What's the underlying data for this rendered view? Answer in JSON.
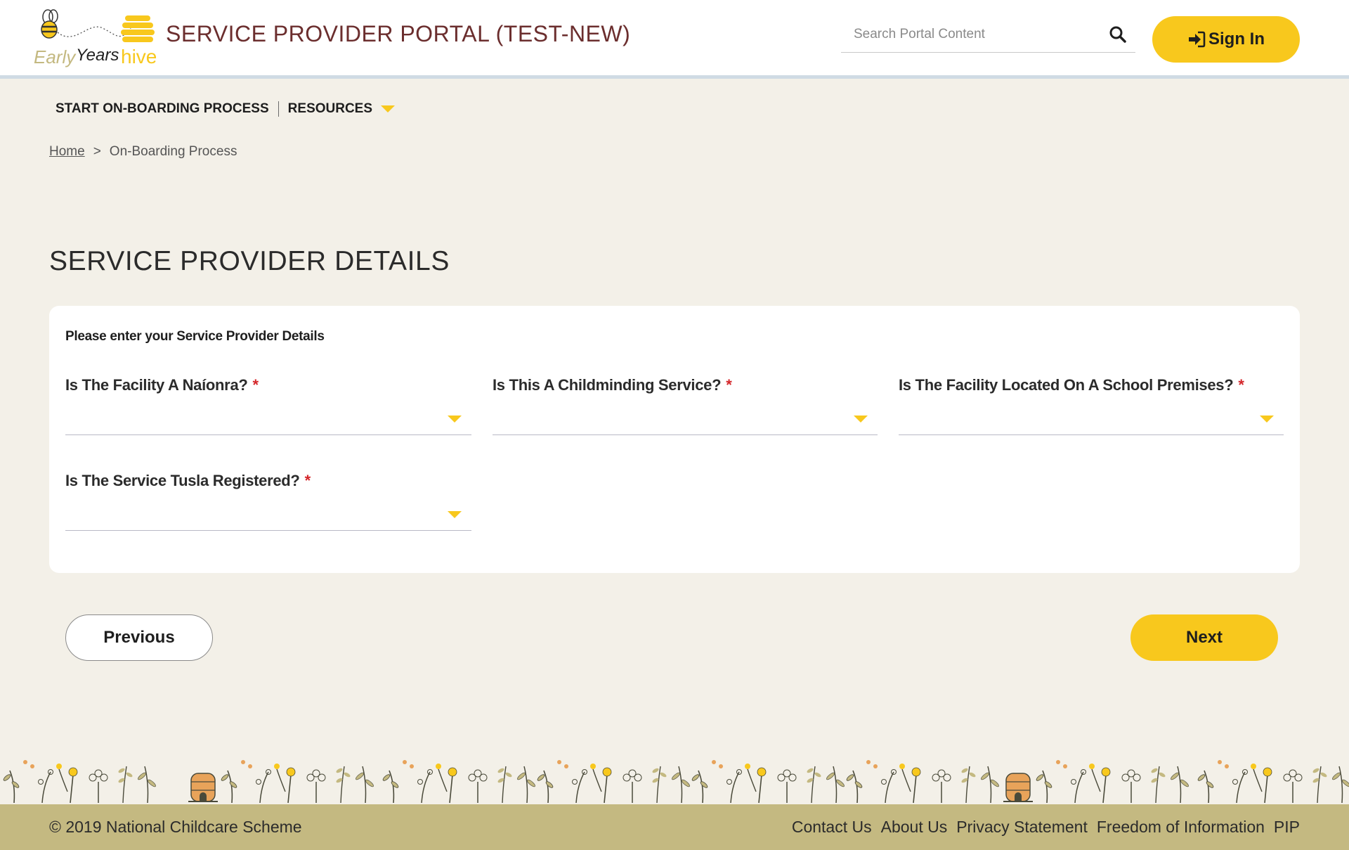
{
  "header": {
    "logo_text": "Early Years hive",
    "portal_title": "SERVICE PROVIDER PORTAL (TEST-NEW)",
    "search_placeholder": "Search Portal Content",
    "sign_in_label": "Sign In"
  },
  "nav": {
    "items": [
      {
        "label": "START ON-BOARDING PROCESS"
      },
      {
        "label": "RESOURCES"
      }
    ]
  },
  "breadcrumb": {
    "home": "Home",
    "separator": ">",
    "current": "On-Boarding Process"
  },
  "page": {
    "title": "SERVICE PROVIDER DETAILS",
    "instruction": "Please enter your Service Provider Details"
  },
  "form": {
    "required_marker": "*",
    "fields": [
      {
        "label": "Is The Facility A Naíonra?",
        "value": ""
      },
      {
        "label": "Is This A Childminding Service?",
        "value": ""
      },
      {
        "label": "Is The Facility Located On A School Premises?",
        "value": ""
      },
      {
        "label": "Is The Service Tusla Registered?",
        "value": ""
      }
    ]
  },
  "buttons": {
    "previous": "Previous",
    "next": "Next"
  },
  "footer": {
    "copyright": "© 2019 National Childcare Scheme",
    "links": [
      "Contact Us",
      "About Us",
      "Privacy Statement",
      "Freedom of Information",
      "PIP"
    ]
  },
  "colors": {
    "accent_yellow": "#f8c81d",
    "title_maroon": "#6b2e2e",
    "footer_bg": "#c4b981",
    "page_bg": "#f3f0e8",
    "required_red": "#d4262a"
  },
  "icons": {
    "search": "search-icon",
    "sign_in": "sign-in-icon",
    "dropdown": "chevron-down-icon",
    "logo": "bee-logo"
  }
}
